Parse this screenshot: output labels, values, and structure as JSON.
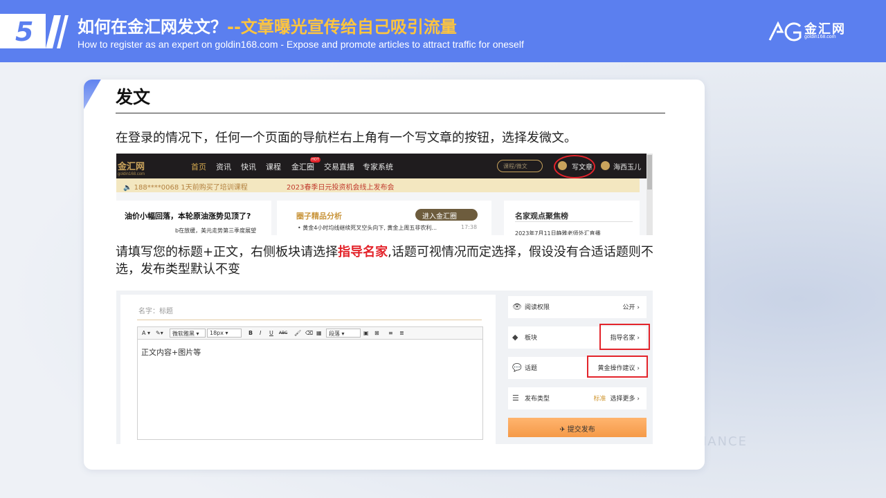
{
  "header": {
    "number": "5",
    "title_main": "如何在金汇网发文？",
    "title_highlight": "--文章曝光宣传给自己吸引流量",
    "subtitle": "How to register as an expert on goldin168.com - Expose and promote articles to attract traffic for oneself",
    "logo_name": "金汇网",
    "logo_url": "goldin168.com"
  },
  "section": {
    "title": "发文",
    "para1": "在登录的情况下，任何一个页面的导航栏右上角有一个写文章的按钮，选择发微文。",
    "para2_before": "请填写您的标题+正文，右侧板块请选择",
    "para2_red": "指导名家",
    "para2_after": ",话题可视情况而定选择，假设没有合适话题则不选，发布类型默认不变"
  },
  "shot1": {
    "logo": "金汇网",
    "logo_sub": "goldin168.com",
    "nav": [
      "首页",
      "资讯",
      "快讯",
      "课程",
      "金汇圈",
      "交易直播",
      "专家系统"
    ],
    "hot_badge": "HOT",
    "search_placeholder": "课程/微文",
    "write_label": "写文章",
    "user_name": "海西玉儿",
    "ticker1": "188****0068 1天前购买了培训课程",
    "ticker2": "2023春季日元投资机会线上发布会",
    "news_title": "油价小幅回落，本轮原油涨势见顶了?",
    "news_sub": "b在放缓，美元走势第三季度展望",
    "col2_title": "圈子精品分析",
    "enter_btn": "进入金汇圈",
    "col2_news": "• 黄金4小时均线继续死叉空头向下, 黄金上周五非农利...",
    "col2_time": "17:38",
    "col3_title": "名家观点聚焦榜",
    "col3_news": "2023年7月11日静雅老师外汇直播"
  },
  "shot2": {
    "title_placeholder": "名字：标题",
    "toolbar": {
      "font": "A",
      "font_family": "微软雅黑",
      "font_size": "18px",
      "bold": "B",
      "italic": "I",
      "underline": "U",
      "strike": "ABC",
      "paragraph": "段落"
    },
    "body_text": "正文内容+图片等",
    "rows": [
      {
        "icon": "👁",
        "label": "阅读权限",
        "value": "公开 ›"
      },
      {
        "icon": "◆",
        "label": "板块",
        "value": "指导名家 ›"
      },
      {
        "icon": "💬",
        "label": "话题",
        "value": "黄金操作建议 ›"
      },
      {
        "icon": "☰",
        "label": "发布类型",
        "value_gold": "标准",
        "value": "选择更多 ›"
      }
    ],
    "submit": "✈ 提交发布"
  },
  "watermark": "FORMANCE",
  "colors": {
    "accent": "#5b7fef",
    "highlight": "#ffc53d",
    "red": "#e3232a"
  }
}
